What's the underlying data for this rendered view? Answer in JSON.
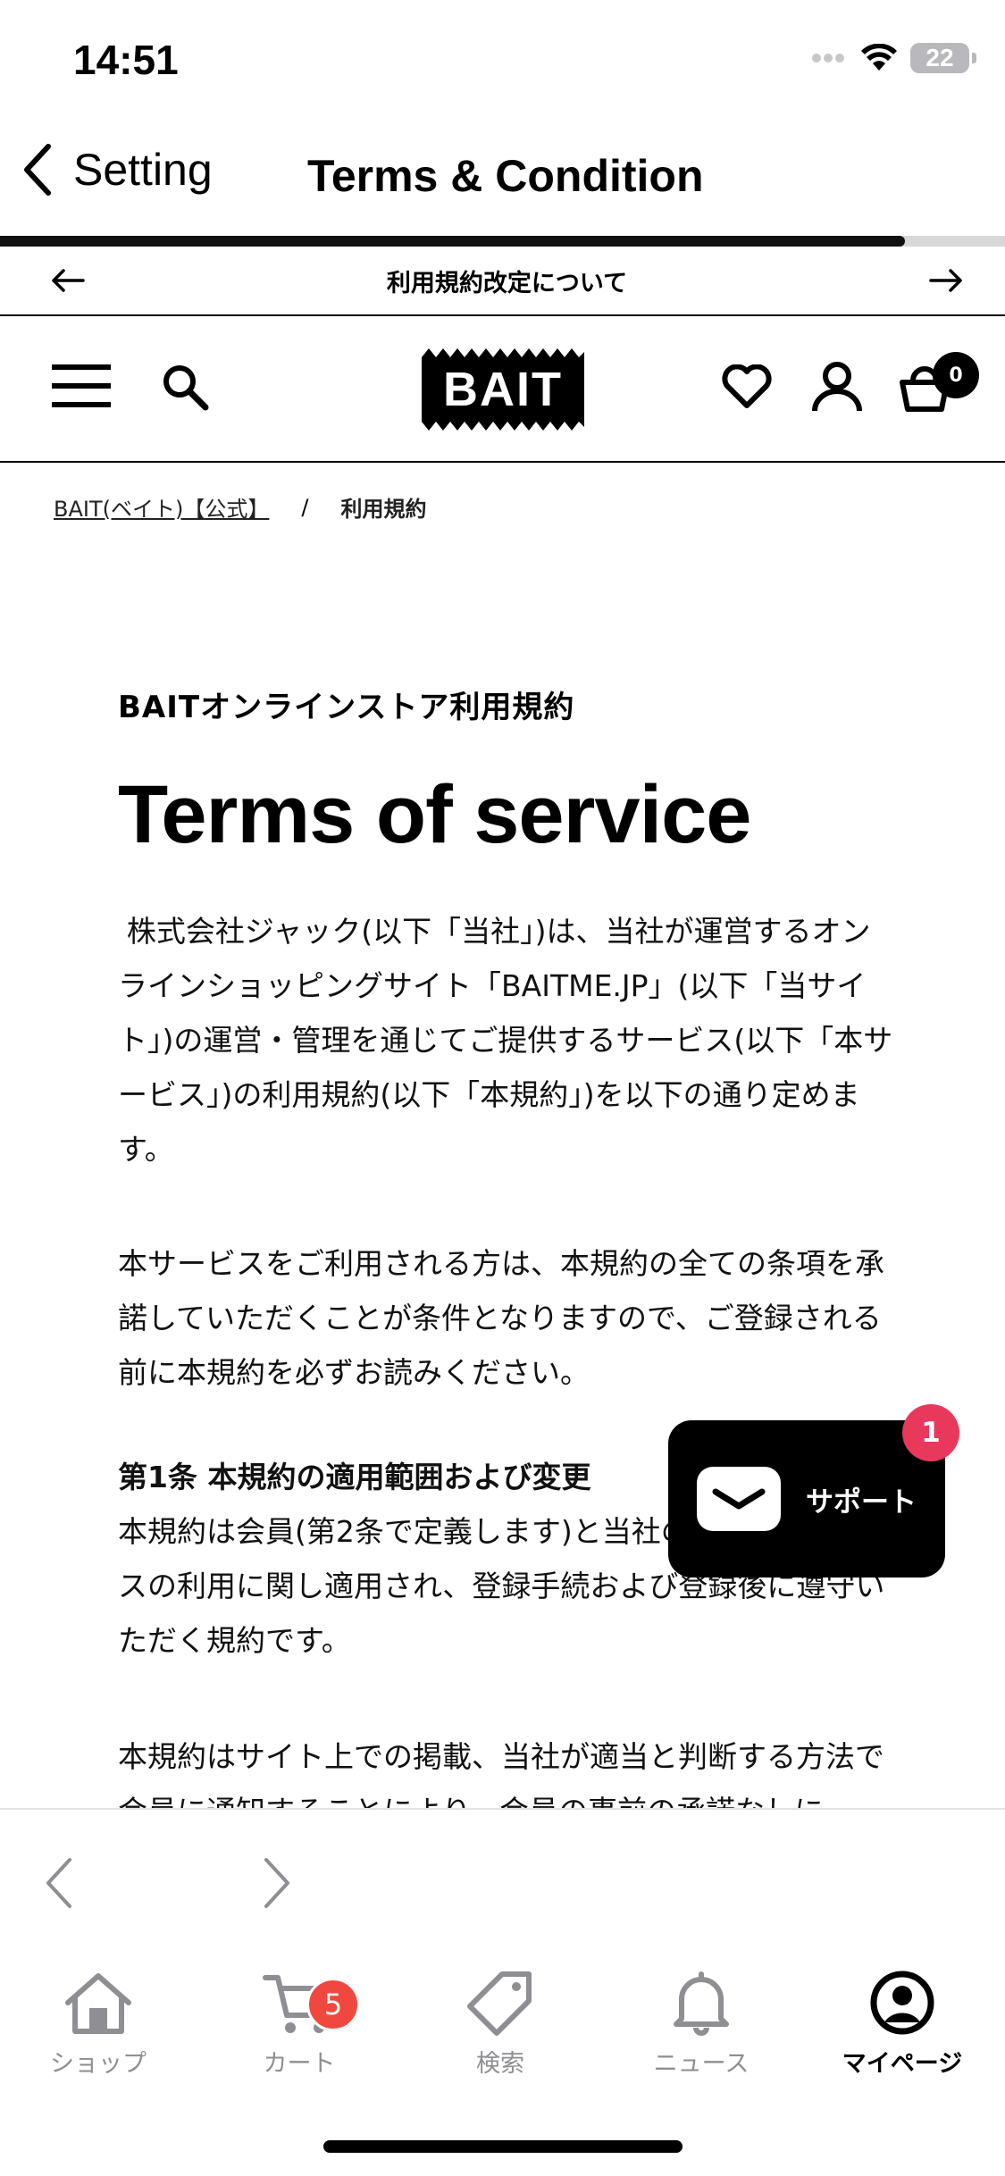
{
  "status_bar": {
    "time": "14:51",
    "battery": "22"
  },
  "nav": {
    "back_label": "Setting",
    "title": "Terms & Condition",
    "progress": 0.9
  },
  "announcement": {
    "text": "利用規約改定について"
  },
  "header": {
    "logo": "BAIT",
    "cart_count": "0"
  },
  "breadcrumb": {
    "home": "BAIT(ベイト)【公式】",
    "separator": "/",
    "current": "利用規約"
  },
  "content": {
    "store_title": "BAITオンラインストア利用規約",
    "heading": "Terms of service",
    "paragraphs": [
      "株式会社ジャック(以下「当社」)は、当社が運営するオンラインショッピングサイト「BAITME.JP」(以下「当サイト」)の運営・管理を通じてご提供するサービス(以下「本サービス」)の利用規約(以下「本規約」)を以下の通り定めます。",
      "本サービスをご利用される方は、本規約の全ての条項を承諾していただくことが条件となりますので、ご登録される前に本規約を必ずお読みください。"
    ],
    "section1_title": "第1条 本規約の適用範囲および変更",
    "section1_body": "本規約は会員(第2条で定義します)と当社の間の本サービスの利用に関し適用され、登録手続および登録後に遵守いただく規約です。",
    "section1_body2": "本規約はサイト上での掲載、当社が適当と判断する方法で会員に通知することにより、会員の事前の承諾なしに"
  },
  "support": {
    "label": "サポート",
    "badge": "1"
  },
  "tabbar": {
    "tabs": [
      {
        "label": "ショップ",
        "icon": "home-icon"
      },
      {
        "label": "カート",
        "icon": "cart-icon",
        "badge": "5"
      },
      {
        "label": "検索",
        "icon": "tag-icon"
      },
      {
        "label": "ニュース",
        "icon": "bell-icon"
      },
      {
        "label": "マイページ",
        "icon": "account-icon",
        "active": true
      }
    ]
  }
}
